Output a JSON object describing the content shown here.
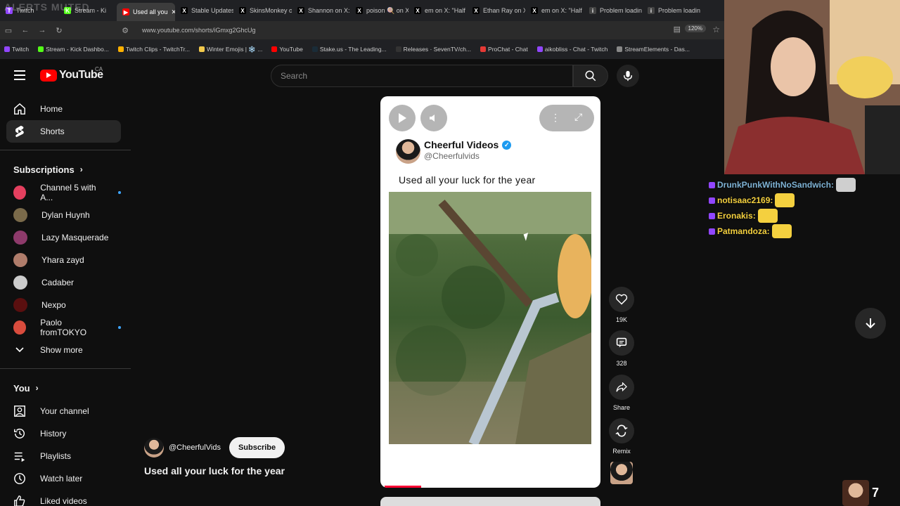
{
  "overlay": {
    "alerts_text": "ALERTS MUTED"
  },
  "browser": {
    "tabs": [
      {
        "label": "Twitch",
        "color": "#9146ff",
        "glyph": "T"
      },
      {
        "label": "Stream - Ki",
        "color": "#53fc18",
        "glyph": "K"
      },
      {
        "label": "Used all you",
        "color": "#ff0000",
        "glyph": "▶",
        "active": true
      },
      {
        "label": "Stable Updates",
        "color": "#000000",
        "glyph": "X"
      },
      {
        "label": "SkinsMonkey o",
        "color": "#000000",
        "glyph": "X"
      },
      {
        "label": "Shannon on X:",
        "color": "#000000",
        "glyph": "X"
      },
      {
        "label": "poison 🍭 on X",
        "color": "#000000",
        "glyph": "X"
      },
      {
        "label": "em on X: \"Half",
        "color": "#000000",
        "glyph": "X"
      },
      {
        "label": "Ethan Ray on X",
        "color": "#000000",
        "glyph": "X"
      },
      {
        "label": "em on X: \"Half",
        "color": "#000000",
        "glyph": "X"
      },
      {
        "label": "Problem loadin",
        "color": "#444444",
        "glyph": "i"
      },
      {
        "label": "Problem loadin",
        "color": "#444444",
        "glyph": "i"
      }
    ],
    "url": "www.youtube.com/shorts/iGmxg2GhcUg",
    "zoom": "120%",
    "bookmarks": [
      {
        "label": "Twitch",
        "color": "#9146ff"
      },
      {
        "label": "Stream - Kick Dashbo...",
        "color": "#53fc18"
      },
      {
        "label": "Twitch Clips - TwitchTr...",
        "color": "#ffb100"
      },
      {
        "label": "Winter Emojis | ❄️ ...",
        "color": "#f2c94c"
      },
      {
        "label": "YouTube",
        "color": "#ff0000"
      },
      {
        "label": "Stake.us - The Leading...",
        "color": "#1a2c38"
      },
      {
        "label": "Releases · SevenTV/ch...",
        "color": "#333333"
      },
      {
        "label": "ProChat - Chat",
        "color": "#e53935"
      },
      {
        "label": "aikobliss - Chat - Twitch",
        "color": "#9146ff"
      },
      {
        "label": "StreamElements - Das...",
        "color": "#888888"
      }
    ]
  },
  "header": {
    "logo_text": "YouTube",
    "country": "CA",
    "search_placeholder": "Search"
  },
  "sidebar": {
    "top": [
      {
        "label": "Home",
        "icon": "home-icon"
      },
      {
        "label": "Shorts",
        "icon": "shorts-icon",
        "active": true
      }
    ],
    "subscriptions_title": "Subscriptions",
    "subscriptions": [
      {
        "label": "Channel 5 with A...",
        "color": "#e4405f",
        "live": true
      },
      {
        "label": "Dylan Huynh",
        "color": "#7a6a4a",
        "live": false
      },
      {
        "label": "Lazy Masquerade",
        "color": "#8e3a6b",
        "live": false
      },
      {
        "label": "Yhara zayd",
        "color": "#b07d6b",
        "live": false
      },
      {
        "label": "Cadaber",
        "color": "#cccccc",
        "live": false
      },
      {
        "label": "Nexpo",
        "color": "#5a0f0f",
        "live": false
      },
      {
        "label": "Paolo fromTOKYO",
        "color": "#d94c3d",
        "live": true
      }
    ],
    "show_more": "Show more",
    "you_title": "You",
    "you_items": [
      {
        "label": "Your channel",
        "icon": "your-channel-icon"
      },
      {
        "label": "History",
        "icon": "history-icon"
      },
      {
        "label": "Playlists",
        "icon": "playlists-icon"
      },
      {
        "label": "Watch later",
        "icon": "watch-later-icon"
      },
      {
        "label": "Liked videos",
        "icon": "liked-videos-icon"
      }
    ]
  },
  "short": {
    "tweet_name": "Cheerful Videos",
    "tweet_handle": "@Cheerfulvids",
    "tweet_text": "Used all your luck for the year",
    "likes": "19K",
    "comments": "328",
    "share_label": "Share",
    "remix_label": "Remix",
    "channel_handle": "@CheerfulVids",
    "subscribe_label": "Subscribe",
    "title": "Used all your luck for the year"
  },
  "chat": {
    "messages": [
      {
        "user": "DrunkPunkWithNoSandwich:",
        "color": "#7fb3d5"
      },
      {
        "user": "notisaac2169:",
        "color": "#f4d03f"
      },
      {
        "user": "Eronakis:",
        "color": "#f4d03f"
      },
      {
        "user": "Patmandoza:",
        "color": "#f4d03f"
      }
    ]
  },
  "viewer_count": "7"
}
